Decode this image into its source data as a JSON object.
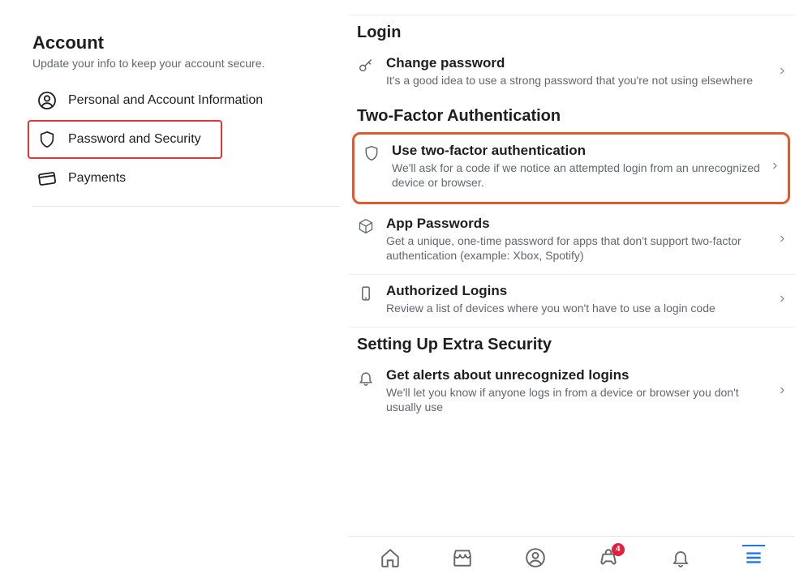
{
  "left": {
    "title": "Account",
    "subtitle": "Update your info to keep your account secure.",
    "items": [
      {
        "label": "Personal and Account Information"
      },
      {
        "label": "Password and Security"
      },
      {
        "label": "Payments"
      }
    ]
  },
  "right": {
    "sections": [
      {
        "title": "Login",
        "items": [
          {
            "title": "Change password",
            "desc": "It's a good idea to use a strong password that you're not using elsewhere"
          }
        ]
      },
      {
        "title": "Two-Factor Authentication",
        "items": [
          {
            "title": "Use two-factor authentication",
            "desc": "We'll ask for a code if we notice an attempted login from an unrecognized device or browser."
          },
          {
            "title": "App Passwords",
            "desc": "Get a unique, one-time password for apps that don't support two-factor authentication (example: Xbox, Spotify)"
          },
          {
            "title": "Authorized Logins",
            "desc": "Review a list of devices where you won't have to use a login code"
          }
        ]
      },
      {
        "title": "Setting Up Extra Security",
        "items": [
          {
            "title": "Get alerts about unrecognized logins",
            "desc": "We'll let you know if anyone logs in from a device or browser you don't usually use"
          }
        ]
      }
    ]
  },
  "tabbar": {
    "badge_count": "4"
  }
}
